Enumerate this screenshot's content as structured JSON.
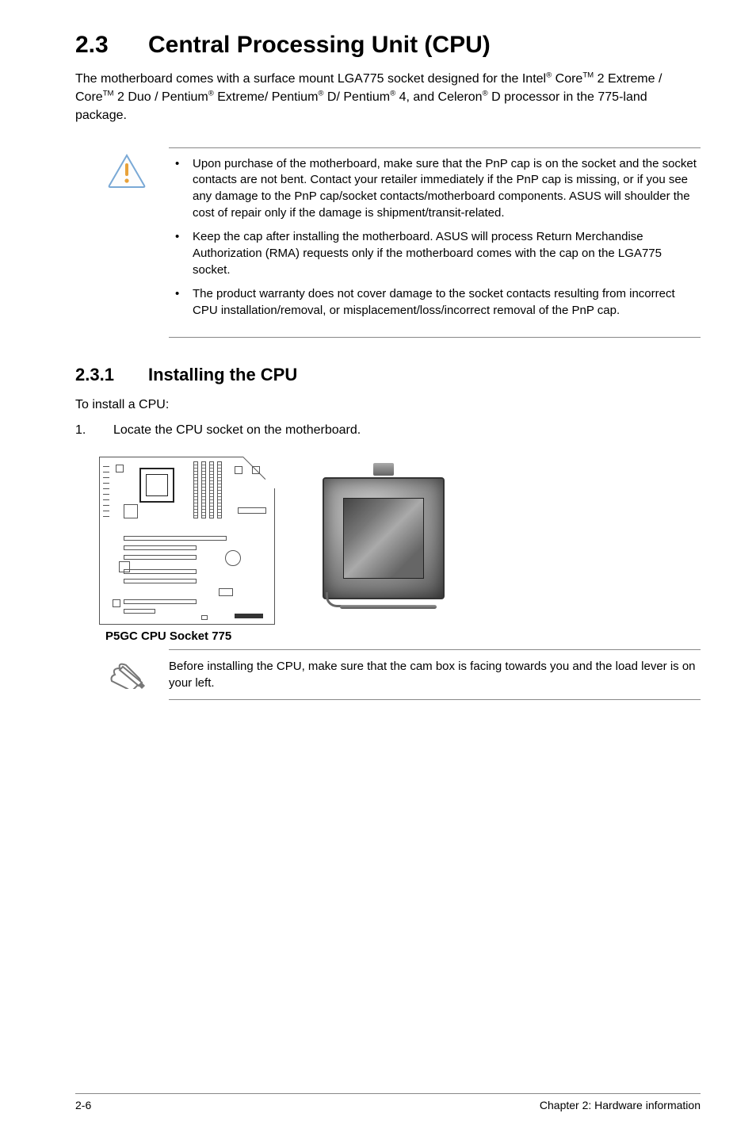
{
  "heading": {
    "number": "2.3",
    "title": "Central Processing Unit (CPU)"
  },
  "intro": "The motherboard comes with a surface mount LGA775 socket designed for the Intel® Core™ 2 Extreme / Core™ 2 Duo / Pentium® Extreme/ Pentium® D/ Pentium® 4, and Celeron® D processor in the 775-land package.",
  "warnings": [
    "Upon purchase of the motherboard, make sure that the PnP cap is on the socket and the socket contacts are not bent. Contact your retailer immediately if the PnP cap is missing, or if you see any damage to the PnP cap/socket contacts/motherboard components. ASUS will shoulder the cost of repair only if the damage is shipment/transit-related.",
    "Keep the cap after installing the motherboard. ASUS will process Return Merchandise Authorization (RMA) requests only if the motherboard comes with the cap on the LGA775 socket.",
    "The product warranty does not cover damage to the socket contacts resulting from incorrect CPU installation/removal, or misplacement/loss/incorrect removal of the PnP cap."
  ],
  "subheading": {
    "number": "2.3.1",
    "title": "Installing the CPU"
  },
  "lead": "To install a CPU:",
  "step1": {
    "n": "1.",
    "text": "Locate the CPU socket on the motherboard."
  },
  "figcaption": "P5GC CPU Socket 775",
  "note": "Before installing the CPU, make sure that the cam box is facing towards you and the load lever is on your left.",
  "footer": {
    "left": "2-6",
    "right": "Chapter 2: Hardware information"
  },
  "icons": {
    "warning": "warning-triangle-icon",
    "note": "pencil-note-icon"
  }
}
